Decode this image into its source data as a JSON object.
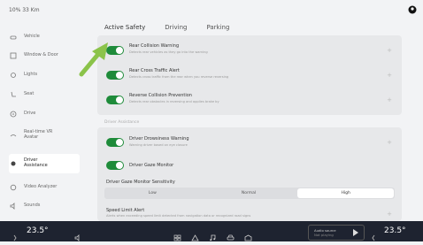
{
  "status_bar": {
    "text": "10% 33 Km"
  },
  "sidebar": {
    "items": [
      {
        "label": "Vehicle",
        "icon": "car-icon"
      },
      {
        "label": "Window & Door",
        "icon": "window-icon"
      },
      {
        "label": "Lights",
        "icon": "light-icon"
      },
      {
        "label": "Seat",
        "icon": "seat-icon"
      },
      {
        "label": "Drive",
        "icon": "steering-wheel-icon"
      },
      {
        "label": "Real-time VR\nAvatar",
        "icon": "avatar-icon"
      },
      {
        "label": "Driver\nAssistance",
        "icon": "driver-assist-icon",
        "active": true
      },
      {
        "label": "Video Analyzer",
        "icon": "video-icon"
      },
      {
        "label": "Sounds",
        "icon": "sound-icon"
      }
    ]
  },
  "tabs": [
    {
      "label": "Active Safety",
      "active": true
    },
    {
      "label": "Driving"
    },
    {
      "label": "Parking"
    }
  ],
  "active_safety": {
    "rows": [
      {
        "title": "Rear Collision Warning",
        "subtitle": "Detects rear vehicles as they go into the warning",
        "on": true
      },
      {
        "title": "Rear Cross Traffic Alert",
        "subtitle": "Detects cross traffic from the rear when you reverse reversing",
        "on": true
      },
      {
        "title": "Reverse Collision Prevention",
        "subtitle": "Detects rear obstacles in reversing and applies brake by",
        "on": true
      }
    ]
  },
  "driver_assistance": {
    "section_label": "Driver Assistance",
    "drowsiness_title": "Driver Drowsiness Warning",
    "drowsiness_subtitle": "Warning driver based on eye closure",
    "gaze_title": "Driver Gaze Monitor",
    "sensitivity_label": "Driver Gaze Monitor Sensitivity",
    "sensitivity_options": [
      "Low",
      "Normal",
      "High"
    ],
    "sensitivity_selected": "High",
    "speed_title": "Speed Limit Alert",
    "speed_subtitle": "Alerts when exceeding speed limit detected from navigation data or recognized road signs"
  },
  "taskbar": {
    "left_temp": "23.5°",
    "right_temp": "23.5°",
    "media_line1": "Audio source",
    "media_line2": "Not playing"
  },
  "colors": {
    "toggle_on": "#1e8b3a",
    "accent": "#4a8f6a",
    "arrow": "#8bc34a",
    "taskbar": "#1e2330"
  }
}
